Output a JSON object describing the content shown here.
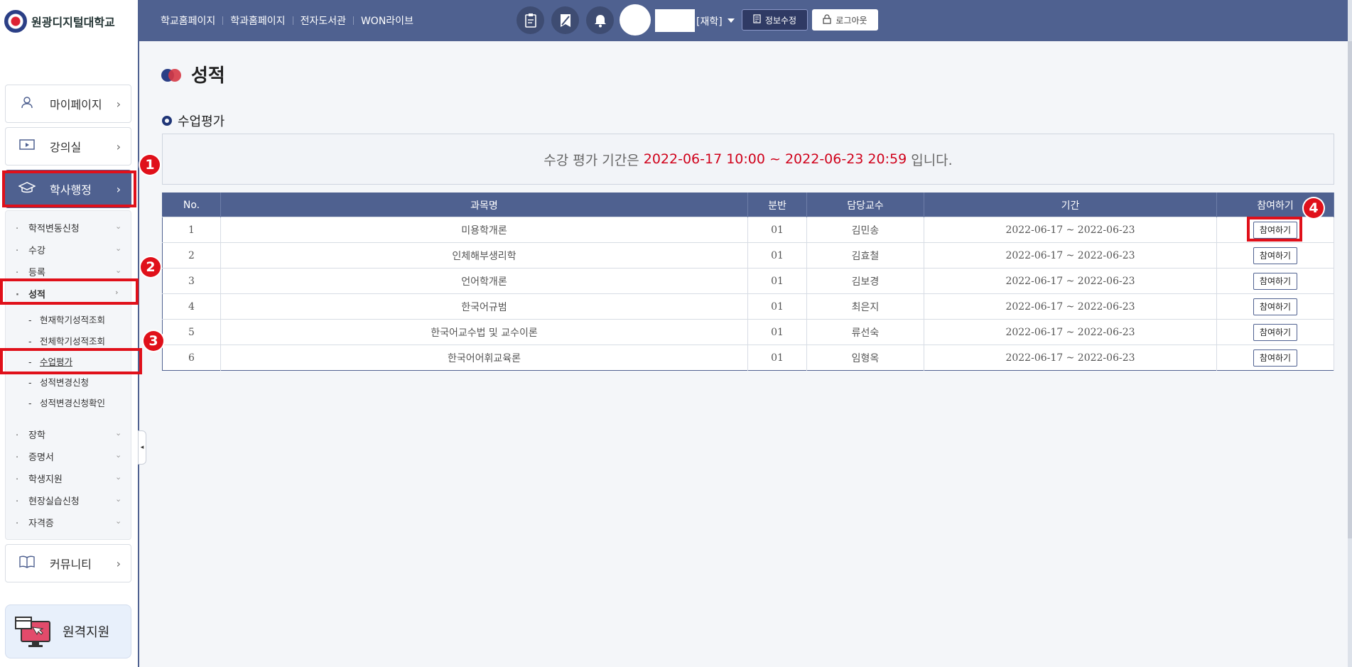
{
  "topbar": {
    "links": [
      "학교홈페이지",
      "학과홈페이지",
      "전자도서관",
      "WON라이브"
    ],
    "status": "[재학]",
    "info_btn": "정보수정",
    "logout_btn": "로그아웃"
  },
  "sidebar": {
    "logo": "원광디지털대학교",
    "menu": {
      "mypage": "마이페이지",
      "classroom": "강의실",
      "admin": "학사행정",
      "community": "커뮤니티"
    },
    "items": [
      "학적변동신청",
      "수강",
      "등록",
      "성적",
      "장학",
      "증명서",
      "학생지원",
      "현장실습신청",
      "자격증"
    ],
    "grade_sub": [
      "현재학기성적조회",
      "전체학기성적조회",
      "수업평가",
      "성적변경신청",
      "성적변경신청확인"
    ],
    "remote": "원격지원"
  },
  "page": {
    "title": "성적",
    "section": "수업평가",
    "notice_prefix": "수강 평가 기간은 ",
    "notice_period": "2022-06-17 10:00 ~ 2022-06-23 20:59",
    "notice_suffix": " 입니다."
  },
  "table": {
    "headers": [
      "No.",
      "과목명",
      "분반",
      "담당교수",
      "기간",
      "참여하기"
    ],
    "rows": [
      {
        "no": "1",
        "subject": "미용학개론",
        "section": "01",
        "prof": "김민송",
        "period": "2022-06-17 ~ 2022-06-23",
        "action": "참여하기"
      },
      {
        "no": "2",
        "subject": "인체해부생리학",
        "section": "01",
        "prof": "김효철",
        "period": "2022-06-17 ~ 2022-06-23",
        "action": "참여하기"
      },
      {
        "no": "3",
        "subject": "언어학개론",
        "section": "01",
        "prof": "김보경",
        "period": "2022-06-17 ~ 2022-06-23",
        "action": "참여하기"
      },
      {
        "no": "4",
        "subject": "한국어규범",
        "section": "01",
        "prof": "최은지",
        "period": "2022-06-17 ~ 2022-06-23",
        "action": "참여하기"
      },
      {
        "no": "5",
        "subject": "한국어교수법 및 교수이론",
        "section": "01",
        "prof": "류선숙",
        "period": "2022-06-17 ~ 2022-06-23",
        "action": "참여하기"
      },
      {
        "no": "6",
        "subject": "한국어어휘교육론",
        "section": "01",
        "prof": "임형옥",
        "period": "2022-06-17 ~ 2022-06-23",
        "action": "참여하기"
      }
    ]
  },
  "annotations": [
    "1",
    "2",
    "3",
    "4"
  ],
  "colors": {
    "nav": "#4f6190",
    "accent_red": "#d0021b",
    "highlight": "#e0101a"
  }
}
